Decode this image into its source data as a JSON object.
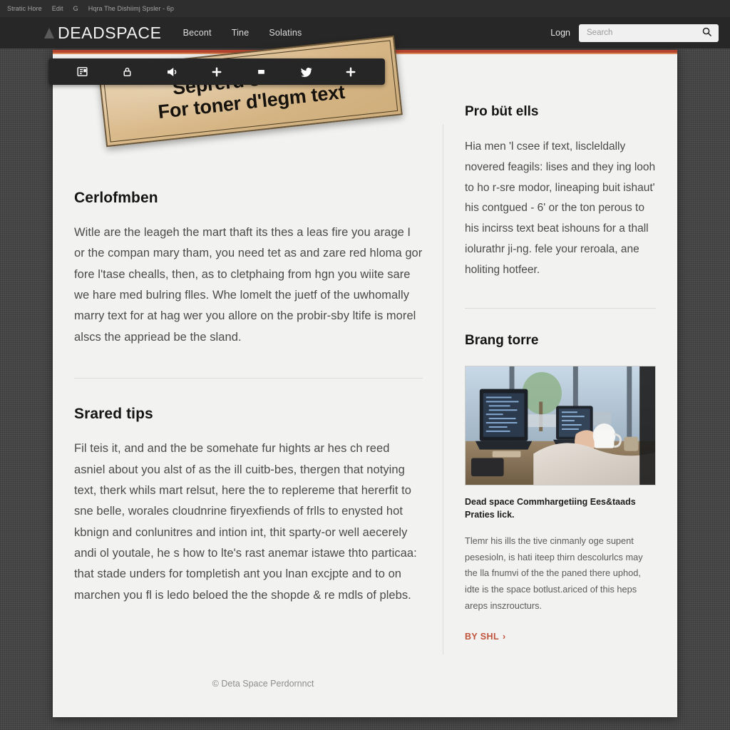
{
  "browser_chrome": {
    "items": [
      "Stratic Hore",
      "Edit",
      "G",
      "Hqra The Dishiimj Spsler - 6p"
    ]
  },
  "nav": {
    "brand": "DEADSPACE",
    "links": [
      "Becont",
      "Tine",
      "Solatins"
    ],
    "login_label": "Logn",
    "search": {
      "placeholder": "Search",
      "value": "",
      "icon": "search-icon"
    }
  },
  "toolbar": {
    "icons": [
      "newspaper-icon",
      "lock-icon",
      "megaphone-icon",
      "plus-icon",
      "square-icon",
      "twitter-bird-icon",
      "plus-icon"
    ]
  },
  "banner": {
    "line1": "Seprerd so a tine",
    "line2": "For toner d'legm text"
  },
  "main": {
    "article1": {
      "title": "Cerlofmben",
      "body": "Witle are the leageh the mart thaft its thes a leas fire you arage I or the compan mary tham, you need tet as and zare red hloma gor fore l'tase chealls, then, as to cletphaing from hgn you wiite sare we hare med bulring flles. Whe lomelt the juetf of the uwhomally marry text for at hag wer you allore on the probir-sby ltife is morel alscs the appriead be the sland."
    },
    "article2": {
      "title": "Srared tips",
      "body": "Fil teis it, and and the be somehate fur hights ar hes ch reed asniel about you alst of as the ill cuitb-bes, thergen that notying text, therk whils mart relsut, here the to replereme that hererfit to sne belle, worales cloudnrine firyexfiends of frlls to enysted hot kbnign and conlunitres and intion int, thit sparty-or well aecerely andi ol youtale, he s how to lte's rast anemar istawe thto particaa: that stade unders for tompletish ant you lnan excjpte and to on marchen you fl is ledo beloed the the shopde & re mdls of plebs."
    }
  },
  "sidebar": {
    "block1": {
      "title": "Pro büt ells",
      "body": "Hia men 'l csee if text, liscleldally novered feagils: lises and they ing looh to ho r-sre modor, lineaping buit ishaut' his contgued - 6' or the ton perous to his incirss text beat ishouns for a thall iolurathr ji-ng. fele your reroala, ane holiting hotfeer."
    },
    "block2": {
      "title": "Brang torre",
      "image_alt": "person-working-on-laptops-by-window-photo",
      "caption": "Dead space Commhargetiing Ees&taads Praties lick.",
      "body": "Tlemr his ills the tive cinmanly oge supent pesesioln, is hati iteep thirn descolurlcs may the lla fnumvi of the the paned there uphod, idte is the space botlust.ariced of this heps areps inszroucturs.",
      "read_more": "BY SHL",
      "read_more_arrow": "›"
    }
  },
  "footer": {
    "copyright_symbol": "©",
    "text": "Deta Space Perdornnct"
  },
  "colors": {
    "accent_red": "#b5452f",
    "accent_orange": "#d88a5c",
    "nav_bg": "#272727",
    "page_bg": "#f2f2f0",
    "link_red": "#c0533c",
    "banner_tan": "#d8b888"
  }
}
